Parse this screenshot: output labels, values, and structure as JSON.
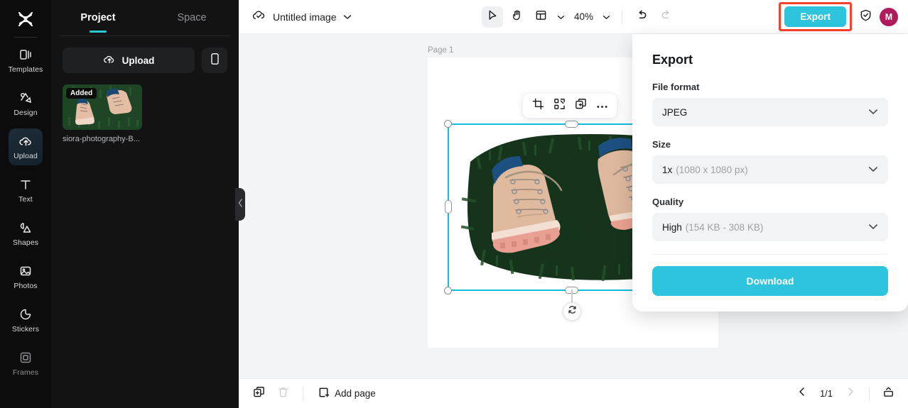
{
  "rail": {
    "logo_icon": "capcut-logo-icon",
    "items": [
      {
        "label": "Templates",
        "icon": "templates-icon",
        "active": false
      },
      {
        "label": "Design",
        "icon": "design-icon",
        "active": false
      },
      {
        "label": "Upload",
        "icon": "upload-cloud-icon",
        "active": true
      },
      {
        "label": "Text",
        "icon": "text-icon",
        "active": false
      },
      {
        "label": "Shapes",
        "icon": "shapes-icon",
        "active": false
      },
      {
        "label": "Photos",
        "icon": "photos-icon",
        "active": false
      },
      {
        "label": "Stickers",
        "icon": "stickers-icon",
        "active": false
      },
      {
        "label": "Frames",
        "icon": "frames-icon",
        "active": false
      }
    ]
  },
  "panel": {
    "tabs": [
      {
        "label": "Project",
        "active": true
      },
      {
        "label": "Space",
        "active": false
      }
    ],
    "upload_button": "Upload",
    "phone_upload_icon": "phone-icon",
    "assets": [
      {
        "badge": "Added",
        "name": "siora-photography-B..."
      }
    ],
    "collapse_icon": "chevron-left-icon"
  },
  "topbar": {
    "cloud_icon": "cloud-saved-icon",
    "doc_title": "Untitled image",
    "title_caret_icon": "chevron-down-icon",
    "tools": [
      {
        "icon": "cursor-select-icon",
        "active": true
      },
      {
        "icon": "hand-pan-icon",
        "active": false
      },
      {
        "icon": "layout-grid-icon",
        "active": false
      }
    ],
    "layout_caret_icon": "chevron-down-icon",
    "zoom_level": "40%",
    "zoom_caret_icon": "chevron-down-icon",
    "undo_icon": "undo-icon",
    "redo_icon": "redo-icon",
    "export_label": "Export",
    "shield_icon": "shield-check-icon",
    "avatar_initial": "M",
    "highlight_color": "#f9412c",
    "accent_color": "#2ec4dd"
  },
  "canvas": {
    "page_label": "Page 1",
    "selection_toolbar": [
      {
        "icon": "crop-icon"
      },
      {
        "icon": "ai-tools-icon"
      },
      {
        "icon": "duplicate-icon"
      },
      {
        "icon": "more-options-icon"
      }
    ],
    "rotate_icon": "rotate-icon",
    "selection_color": "#12bcdb",
    "image_alt": "tan leather boots on dark green grass"
  },
  "bottombar": {
    "duplicate_page_icon": "duplicate-page-icon",
    "delete_page_icon": "trash-icon",
    "add_page_icon": "add-page-icon",
    "add_page_label": "Add page",
    "prev_icon": "chevron-left-icon",
    "page_indicator": "1/1",
    "next_icon": "chevron-right-icon",
    "panel_toggle_icon": "bottom-panel-icon"
  },
  "export_panel": {
    "title": "Export",
    "fields": [
      {
        "label": "File format",
        "value": "JPEG",
        "hint": ""
      },
      {
        "label": "Size",
        "value": "1x",
        "hint": "(1080 x 1080 px)"
      },
      {
        "label": "Quality",
        "value": "High",
        "hint": "(154 KB - 308 KB)"
      }
    ],
    "download_label": "Download",
    "caret_icon": "chevron-down-icon"
  }
}
